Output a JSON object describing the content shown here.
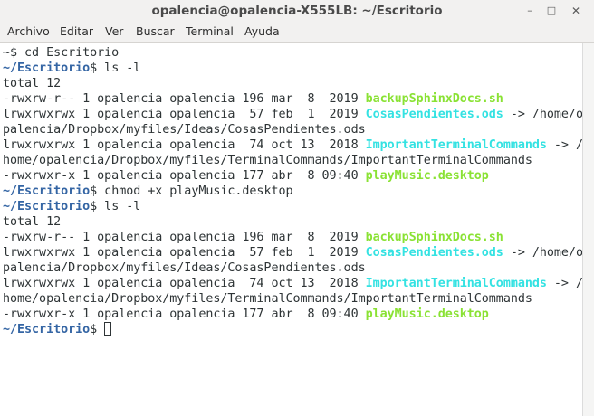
{
  "window": {
    "title": "opalencia@opalencia-X555LB: ~/Escritorio",
    "controls": {
      "minimize": "–",
      "maximize": "□",
      "close": "✕"
    }
  },
  "menu": {
    "items": [
      "Archivo",
      "Editar",
      "Ver",
      "Buscar",
      "Terminal",
      "Ayuda"
    ]
  },
  "terminal": {
    "lines": [
      {
        "text": "~$ cd Escritorio"
      },
      {
        "prompt": "~/Escritorio",
        "cmd": "$ ls -l"
      },
      {
        "text": "total 12"
      },
      {
        "text": "-rwxrw-r-- 1 opalencia opalencia 196 mar  8  2019 ",
        "name": "backupSphinxDocs.sh",
        "kind": "exec"
      },
      {
        "text": "lrwxrwxrwx 1 opalencia opalencia  57 feb  1  2019 ",
        "name": "CosasPendientes.ods",
        "kind": "link",
        "tail": " -> /home/o"
      },
      {
        "text": "palencia/Dropbox/myfiles/Ideas/CosasPendientes.ods"
      },
      {
        "text": "lrwxrwxrwx 1 opalencia opalencia  74 oct 13  2018 ",
        "name": "ImportantTerminalCommands",
        "kind": "link",
        "tail": " -> /"
      },
      {
        "text": "home/opalencia/Dropbox/myfiles/TerminalCommands/ImportantTerminalCommands"
      },
      {
        "text": "-rwxrwxr-x 1 opalencia opalencia 177 abr  8 09:40 ",
        "name": "playMusic.desktop",
        "kind": "exec"
      },
      {
        "prompt": "~/Escritorio",
        "cmd": "$ chmod +x playMusic.desktop"
      },
      {
        "prompt": "~/Escritorio",
        "cmd": "$ ls -l"
      },
      {
        "text": "total 12"
      },
      {
        "text": "-rwxrw-r-- 1 opalencia opalencia 196 mar  8  2019 ",
        "name": "backupSphinxDocs.sh",
        "kind": "exec"
      },
      {
        "text": "lrwxrwxrwx 1 opalencia opalencia  57 feb  1  2019 ",
        "name": "CosasPendientes.ods",
        "kind": "link",
        "tail": " -> /home/o"
      },
      {
        "text": "palencia/Dropbox/myfiles/Ideas/CosasPendientes.ods"
      },
      {
        "text": "lrwxrwxrwx 1 opalencia opalencia  74 oct 13  2018 ",
        "name": "ImportantTerminalCommands",
        "kind": "link",
        "tail": " -> /"
      },
      {
        "text": "home/opalencia/Dropbox/myfiles/TerminalCommands/ImportantTerminalCommands"
      },
      {
        "text": "-rwxrwxr-x 1 opalencia opalencia 177 abr  8 09:40 ",
        "name": "playMusic.desktop",
        "kind": "exec"
      },
      {
        "prompt": "~/Escritorio",
        "cmd": "$ ",
        "cursor": true
      }
    ]
  },
  "colors": {
    "prompt": "#3465a4",
    "executable": "#8ae234",
    "symlink": "#34e2e2",
    "text": "#2e3436"
  }
}
